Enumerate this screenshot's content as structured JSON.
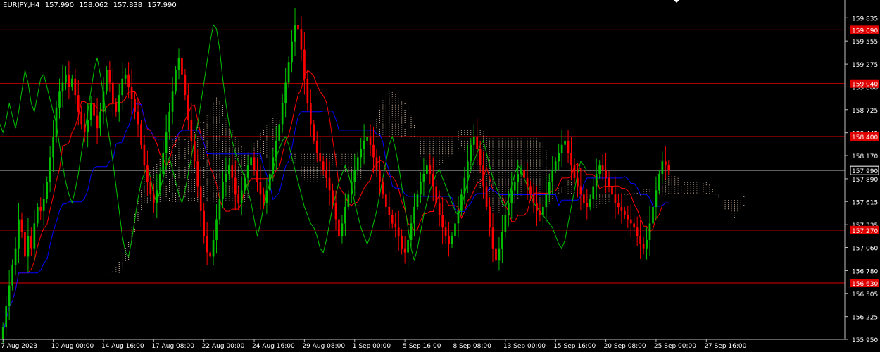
{
  "header": {
    "symbol": "EURJPY,H4",
    "open": "157.990",
    "high": "158.062",
    "low": "157.838",
    "close": "157.990"
  },
  "colors": {
    "background": "#000000",
    "axis": "#c0c0c0",
    "bull_candle": "#00c000",
    "bear_candle": "#ff0000",
    "level_line": "#e00000",
    "level_label_bg": "#e00000",
    "current_price": "#ffffff",
    "tenkan": "#ff0000",
    "kijun": "#0000ff",
    "chikou": "#00c000",
    "kumo": "#f5d5b8"
  },
  "chart_data": {
    "type": "candlestick",
    "title": "EURJPY,H4",
    "ylim": [
      155.95,
      160.05
    ],
    "y_ticks": [
      "159.835",
      "159.555",
      "159.275",
      "159.000",
      "158.725",
      "158.445",
      "158.170",
      "157.890",
      "157.615",
      "157.335",
      "157.060",
      "156.780",
      "156.505",
      "156.225",
      "155.950"
    ],
    "x_ticks": [
      {
        "label": "7 Aug 2023",
        "index": 0
      },
      {
        "label": "10 Aug 00:00",
        "index": 16
      },
      {
        "label": "14 Aug 16:00",
        "index": 32
      },
      {
        "label": "17 Aug 08:00",
        "index": 48
      },
      {
        "label": "22 Aug 00:00",
        "index": 64
      },
      {
        "label": "24 Aug 16:00",
        "index": 80
      },
      {
        "label": "29 Aug 08:00",
        "index": 96
      },
      {
        "label": "1 Sep 00:00",
        "index": 112
      },
      {
        "label": "5 Sep 16:00",
        "index": 128
      },
      {
        "label": "8 Sep 08:00",
        "index": 144
      },
      {
        "label": "13 Sep 00:00",
        "index": 160
      },
      {
        "label": "15 Sep 16:00",
        "index": 176
      },
      {
        "label": "20 Sep 08:00",
        "index": 192
      },
      {
        "label": "25 Sep 00:00",
        "index": 208
      },
      {
        "label": "27 Sep 16:00",
        "index": 224
      }
    ],
    "levels": [
      {
        "price": 159.69,
        "label": "159.690"
      },
      {
        "price": 159.04,
        "label": "159.040"
      },
      {
        "price": 158.4,
        "label": "158.400"
      },
      {
        "price": 157.27,
        "label": "157.270"
      },
      {
        "price": 156.63,
        "label": "156.630"
      }
    ],
    "current_price": {
      "price": 157.99,
      "label": "157.990"
    },
    "closes": [
      156.1,
      156.35,
      156.6,
      156.85,
      157.05,
      157.4,
      157.25,
      156.95,
      157.2,
      157.05,
      157.35,
      157.55,
      157.5,
      157.65,
      157.85,
      158.15,
      158.4,
      158.75,
      158.95,
      159.05,
      159.15,
      159.0,
      159.1,
      158.9,
      158.7,
      158.55,
      158.45,
      158.6,
      158.8,
      158.65,
      158.5,
      158.7,
      158.95,
      159.2,
      159.05,
      158.8,
      158.7,
      158.9,
      159.1,
      159.15,
      159.0,
      158.85,
      158.7,
      158.55,
      158.3,
      158.05,
      157.85,
      157.7,
      157.6,
      157.75,
      157.95,
      158.2,
      158.45,
      158.7,
      158.95,
      159.2,
      159.35,
      159.15,
      158.9,
      158.6,
      158.35,
      158.1,
      157.8,
      157.5,
      157.2,
      157.0,
      156.95,
      157.15,
      157.4,
      157.65,
      157.85,
      157.95,
      158.05,
      157.9,
      157.7,
      157.6,
      157.75,
      157.9,
      158.05,
      158.15,
      158.0,
      157.85,
      157.7,
      157.6,
      157.75,
      157.95,
      158.15,
      158.35,
      158.55,
      158.8,
      159.05,
      159.3,
      159.55,
      159.75,
      159.7,
      159.45,
      159.1,
      158.8,
      158.55,
      158.35,
      158.2,
      158.1,
      158.0,
      157.9,
      157.75,
      157.6,
      157.4,
      157.2,
      157.35,
      157.55,
      157.7,
      157.85,
      158.0,
      158.15,
      158.25,
      158.35,
      158.4,
      158.3,
      158.15,
      158.0,
      157.85,
      157.7,
      157.55,
      157.45,
      157.35,
      157.3,
      157.2,
      157.05,
      157.0,
      157.15,
      157.35,
      157.55,
      157.7,
      157.85,
      157.95,
      158.05,
      157.95,
      157.8,
      157.6,
      157.45,
      157.3,
      157.2,
      157.1,
      157.2,
      157.35,
      157.5,
      157.7,
      157.9,
      158.1,
      158.3,
      158.4,
      158.25,
      158.05,
      157.8,
      157.55,
      157.3,
      157.05,
      156.9,
      157.05,
      157.25,
      157.45,
      157.6,
      157.75,
      157.85,
      157.95,
      158.0,
      157.9,
      157.8,
      157.7,
      157.6,
      157.5,
      157.45,
      157.55,
      157.7,
      157.85,
      158.0,
      158.1,
      158.2,
      158.3,
      158.35,
      158.2,
      158.05,
      157.9,
      157.8,
      157.7,
      157.6,
      157.55,
      157.65,
      157.8,
      157.95,
      158.05,
      158.0,
      157.9,
      157.8,
      157.7,
      157.6,
      157.55,
      157.5,
      157.45,
      157.4,
      157.35,
      157.3,
      157.2,
      157.1,
      157.05,
      157.15,
      157.35,
      157.55,
      157.75,
      157.95,
      158.1,
      158.05,
      157.99
    ]
  }
}
